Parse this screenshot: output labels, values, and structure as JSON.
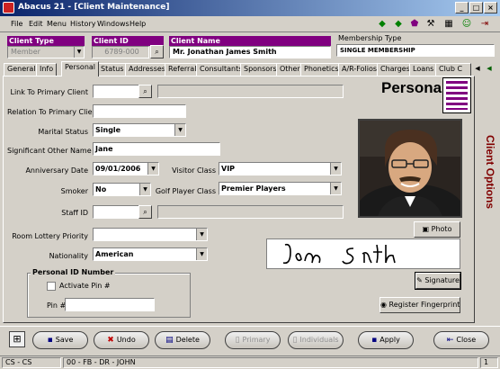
{
  "window": {
    "title": "Abacus 21 - [Client Maintenance]"
  },
  "menu": {
    "items": [
      "File",
      "Edit",
      "Menu",
      "History",
      "Windows",
      "Help"
    ]
  },
  "header": {
    "client_type_label": "Client Type",
    "client_type_value": "Member",
    "client_id_label": "Client ID",
    "client_id_value": "6789-000",
    "client_name_label": "Client Name",
    "client_name_value": "Mr. Jonathan James Smith",
    "membership_type_label": "Membership Type",
    "membership_type_value": "SINGLE MEMBERSHIP"
  },
  "tabs": [
    "General",
    "Info",
    "Personal",
    "Status",
    "Addresses",
    "Referral",
    "Consultants",
    "Sponsors",
    "Other",
    "Phonetics",
    "A/R-Folios",
    "Charges",
    "Loans",
    "Club C"
  ],
  "active_tab": "Personal",
  "panel": {
    "heading": "Personal",
    "side_label": "Client Options",
    "link_primary_label": "Link To Primary Client",
    "link_primary_value": "",
    "relation_label": "Relation To Primary Client",
    "relation_value": "",
    "marital_label": "Marital Status",
    "marital_value": "Single",
    "significant_label": "Significant Other Name",
    "significant_value": "Jane",
    "anniversary_label": "Anniversary Date",
    "anniversary_value": "09/01/2006",
    "visitor_label": "Visitor Class",
    "visitor_value": "VIP",
    "smoker_label": "Smoker",
    "smoker_value": "No",
    "golf_label": "Golf Player Class",
    "golf_value": "Premier Players",
    "staff_label": "Staff ID",
    "staff_value": "",
    "lottery_label": "Room Lottery Priority",
    "lottery_value": "",
    "nationality_label": "Nationality",
    "nationality_value": "American",
    "pin_group_title": "Personal ID Number",
    "activate_pin_label": "Activate Pin #",
    "pin_label": "Pin #",
    "pin_value": "",
    "photo_button": "Photo",
    "signature_button": "Signature",
    "signature_text": "Jon Smith",
    "fingerprint_button": "Register Fingerprint"
  },
  "bottom": {
    "save": "Save",
    "undo": "Undo",
    "delete": "Delete",
    "primary": "Primary",
    "individuals": "Individuals",
    "apply": "Apply",
    "close": "Close"
  },
  "status": {
    "left": "CS - CS",
    "middle": "00 - FB - DR - JOHN",
    "right": "1"
  },
  "colors": {
    "title_bar": "#0a246a",
    "header_label": "#800080",
    "side_label": "#800000"
  }
}
